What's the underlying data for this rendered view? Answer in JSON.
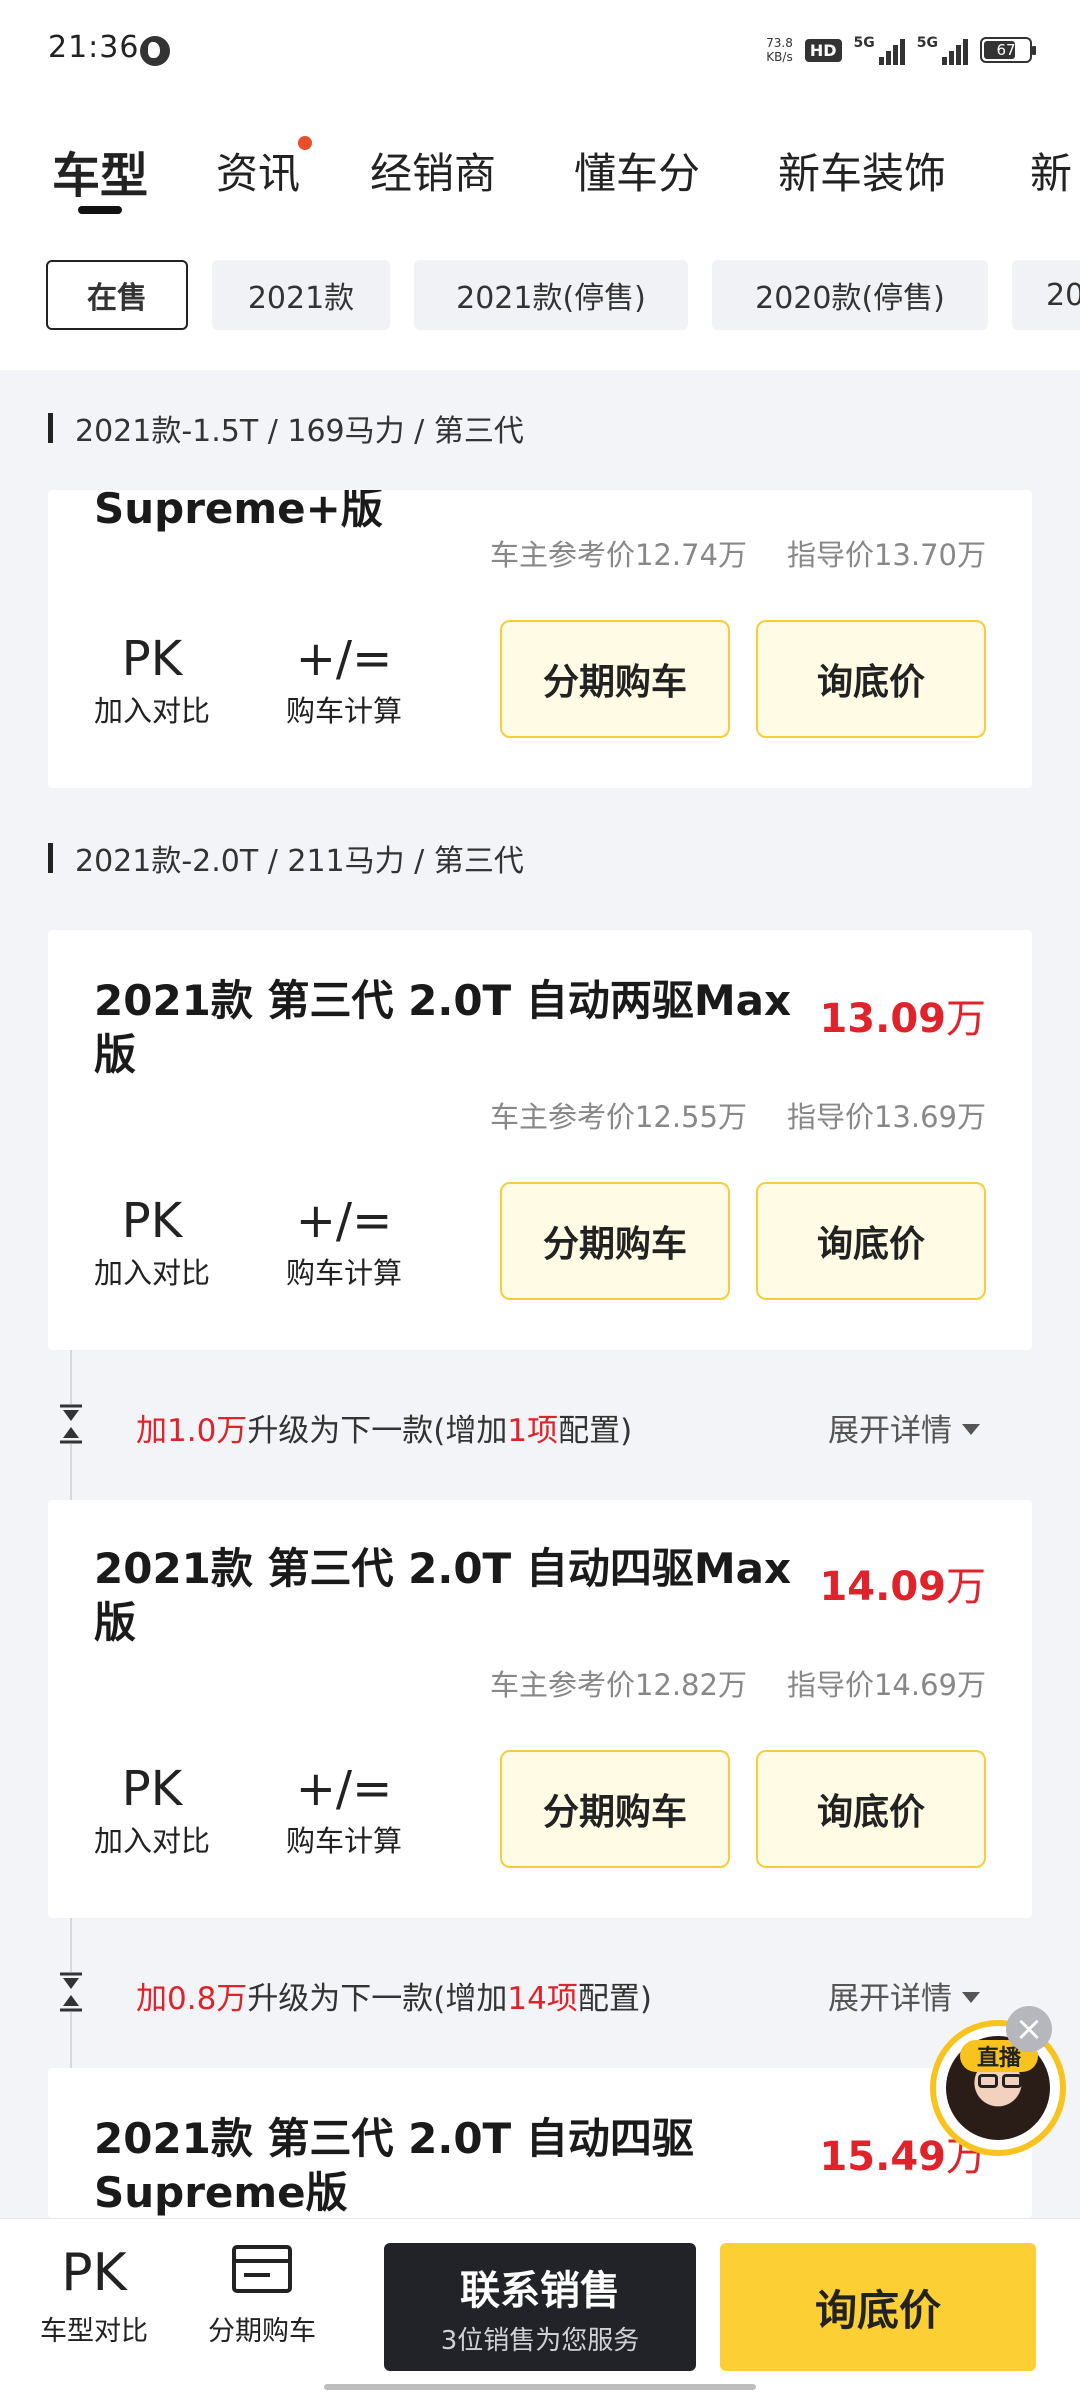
{
  "status_bar": {
    "time": "21:36",
    "net_speed_value": "73.8",
    "net_speed_unit": "KB/s",
    "hd_label": "HD",
    "signal1_label": "5G",
    "signal2_label": "5G",
    "battery": "67"
  },
  "top_tabs": [
    "车型",
    "资讯",
    "经销商",
    "懂车分",
    "新车装饰",
    "新"
  ],
  "filter_chips": [
    "在售",
    "2021款",
    "2021款(停售)",
    "2020款(停售)",
    "20"
  ],
  "sections": [
    {
      "title": "2021款-1.5T / 169马力 / 第三代"
    },
    {
      "title": "2021款-2.0T / 211马力 / 第三代"
    }
  ],
  "cards": [
    {
      "name": "Supreme+版",
      "owner_price": "车主参考价12.74万",
      "guide_price": "指导价13.70万"
    },
    {
      "name": "2021款 第三代 2.0T 自动两驱Max版",
      "price_value": "13.09",
      "price_unit": "万",
      "owner_price": "车主参考价12.55万",
      "guide_price": "指导价13.69万"
    },
    {
      "name": "2021款 第三代 2.0T 自动四驱Max版",
      "price_value": "14.09",
      "price_unit": "万",
      "owner_price": "车主参考价12.82万",
      "guide_price": "指导价14.69万"
    },
    {
      "name": "2021款 第三代 2.0T 自动四驱Supreme版",
      "price_value": "15.49",
      "price_unit": "万"
    }
  ],
  "actions": {
    "pk_icon": "PK",
    "pk_label": "加入对比",
    "calc_icon": "+/=",
    "calc_label": "购车计算",
    "installment": "分期购车",
    "ask_price": "询底价"
  },
  "upgrades": [
    {
      "prefix": "加",
      "amount": "1.0万",
      "middle": "升级为下一款(增加",
      "count": "1项",
      "suffix": "配置)"
    },
    {
      "prefix": "加",
      "amount": "0.8万",
      "middle": "升级为下一款(增加",
      "count": "14项",
      "suffix": "配置)"
    }
  ],
  "expand_label": "展开详情",
  "live": {
    "tag": "直播",
    "close": "×"
  },
  "bottom_bar": {
    "compare_icon": "PK",
    "compare_label": "车型对比",
    "installment_label": "分期购车",
    "contact_title": "联系销售",
    "contact_sub": "3位销售为您服务",
    "ask_price": "询底价"
  },
  "colors": {
    "accent_yellow": "#fcd034",
    "price_red": "#e0222a",
    "button_border": "#f5cd3d",
    "dark_button": "#212328"
  }
}
